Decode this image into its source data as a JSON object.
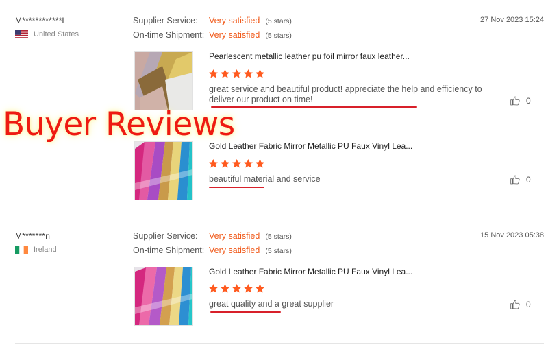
{
  "overlay_text": "Buyer Reviews",
  "colors": {
    "accent": "#f05a1b",
    "star": "#ff5a1f",
    "underline": "#d8202a",
    "overlay": "#ee1a12"
  },
  "reviews": [
    {
      "buyer": "M************l",
      "country": "United States",
      "flag_icon": "us-flag-icon",
      "supplier_service_label": "Supplier Service:",
      "supplier_service_value": "Very satisfied",
      "supplier_service_stars": "(5 stars)",
      "shipment_label": "On-time Shipment:",
      "shipment_value": "Very satisfied",
      "shipment_stars": "(5 stars)",
      "date": "27 Nov 2023 15:24",
      "items": [
        {
          "product_title": "Pearlescent metallic leather pu foil mirror faux leather...",
          "rating": 5,
          "text_line1": "great service and beautiful product! appreciate the help and efficiency to",
          "text_line2": "deliver our product on time!",
          "likes": "0"
        },
        {
          "product_title": "Gold Leather Fabric Mirror Metallic PU Faux Vinyl Lea...",
          "rating": 5,
          "text_line1": "beautiful material and service",
          "likes": "0"
        }
      ]
    },
    {
      "buyer": "M*******n",
      "country": "Ireland",
      "flag_icon": "ireland-flag-icon",
      "supplier_service_label": "Supplier Service:",
      "supplier_service_value": "Very satisfied",
      "supplier_service_stars": "(5 stars)",
      "shipment_label": "On-time Shipment:",
      "shipment_value": "Very satisfied",
      "shipment_stars": "(5 stars)",
      "date": "15 Nov 2023 05:38",
      "items": [
        {
          "product_title": "Gold Leather Fabric Mirror Metallic PU Faux Vinyl Lea...",
          "rating": 5,
          "text_line1": "great quality and a great supplier",
          "likes": "0"
        }
      ]
    }
  ]
}
